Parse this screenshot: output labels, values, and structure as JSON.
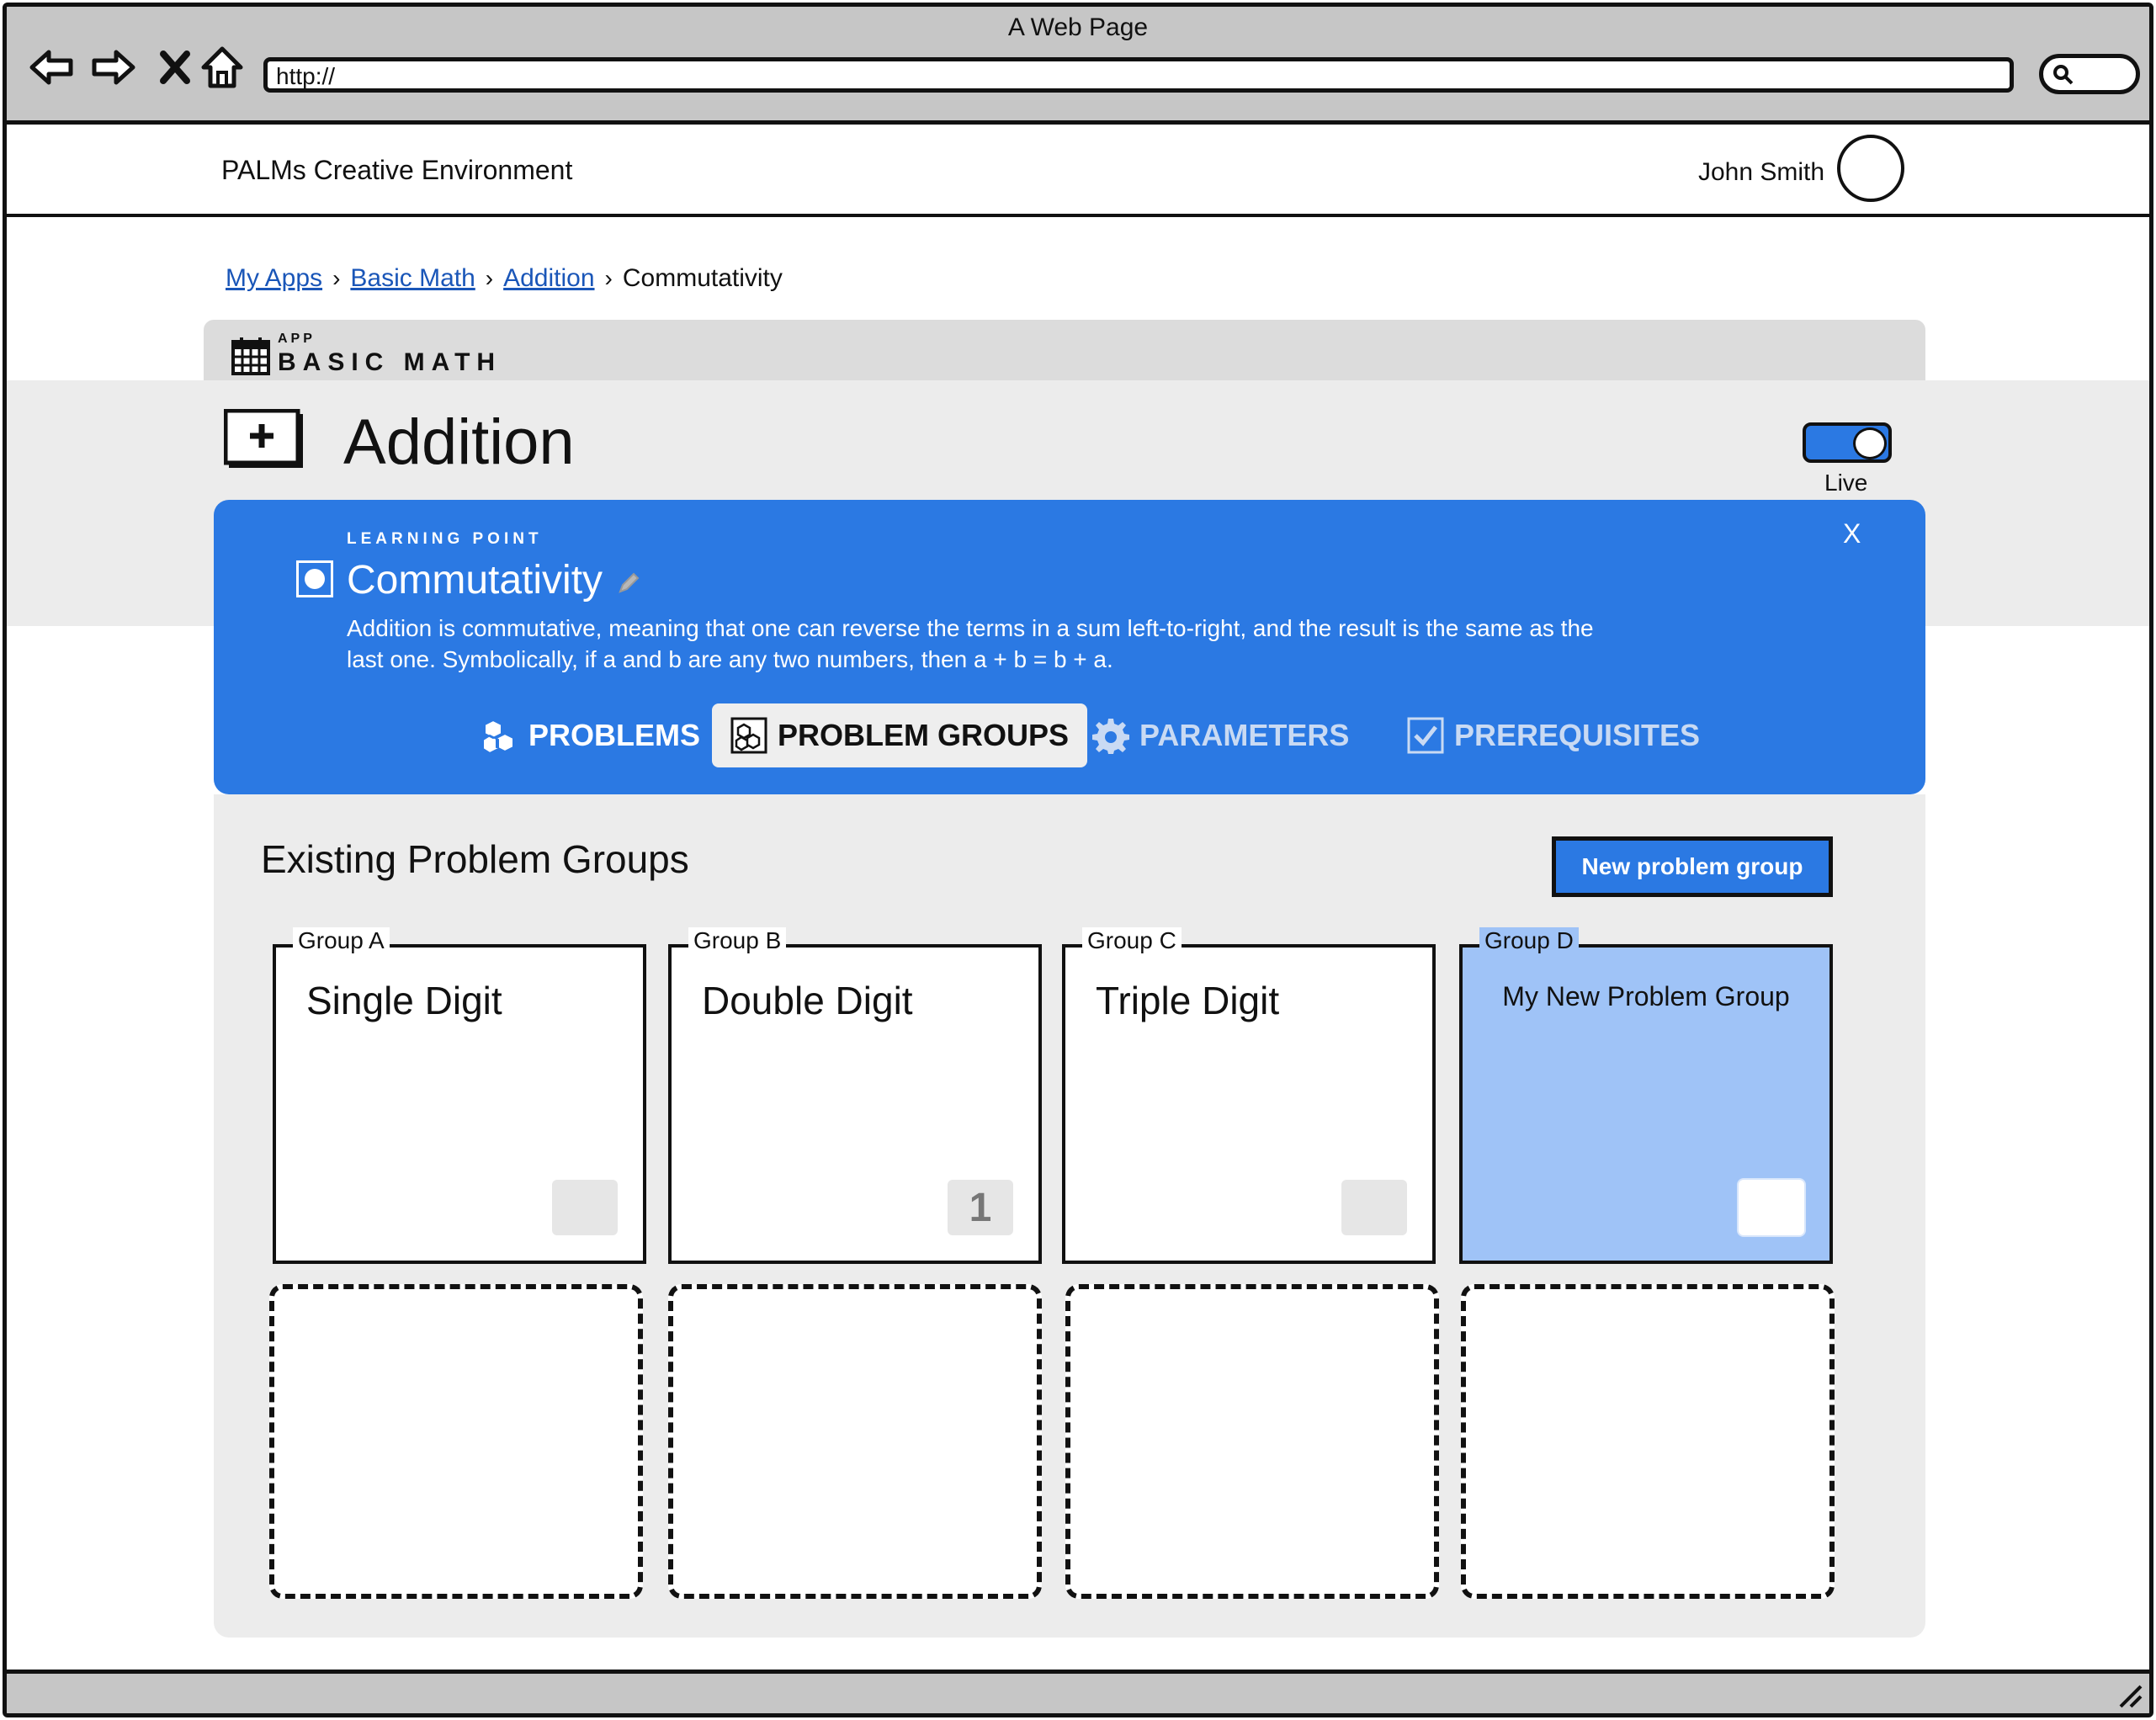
{
  "window": {
    "title": "A Web Page",
    "url": "http://"
  },
  "header": {
    "brand": "PALMs Creative Environment",
    "user_name": "John Smith"
  },
  "breadcrumb": {
    "items": [
      "My Apps",
      "Basic Math",
      "Addition"
    ],
    "current": "Commutativity"
  },
  "app": {
    "caption": "APP",
    "name": "BASIC MATH"
  },
  "page": {
    "title": "Addition",
    "live_label": "Live",
    "live_on": true
  },
  "learning_point": {
    "caption": "LEARNING POINT",
    "title": "Commutativity",
    "description": "Addition is commutative, meaning that one can reverse the terms in a sum left-to-right, and the result is the same as the last one. Symbolically, if a and b are any two numbers, then a + b = b + a.",
    "close": "X"
  },
  "tabs": [
    {
      "label": "PROBLEMS",
      "icon": "cubes-icon",
      "active": false
    },
    {
      "label": "PROBLEM GROUPS",
      "icon": "grouped-cubes-icon",
      "active": true
    },
    {
      "label": "PARAMETERS",
      "icon": "gear-icon",
      "active": false
    },
    {
      "label": "PREREQUISITES",
      "icon": "checkbox-icon",
      "active": false
    }
  ],
  "groups_panel": {
    "title": "Existing Problem Groups",
    "new_button": "New problem group",
    "groups": [
      {
        "legend": "Group A",
        "name": "Single Digit",
        "count": ""
      },
      {
        "legend": "Group B",
        "name": "Double Digit",
        "count": "1"
      },
      {
        "legend": "Group C",
        "name": "Triple Digit",
        "count": ""
      },
      {
        "legend": "Group D",
        "name": "My New Problem Group",
        "count": "",
        "selected": true
      }
    ],
    "empty_slots": 4
  },
  "colors": {
    "accent": "#2b79e3",
    "selected": "#9fc3f7",
    "chrome": "#c6c6c6",
    "panel": "#ececec"
  }
}
